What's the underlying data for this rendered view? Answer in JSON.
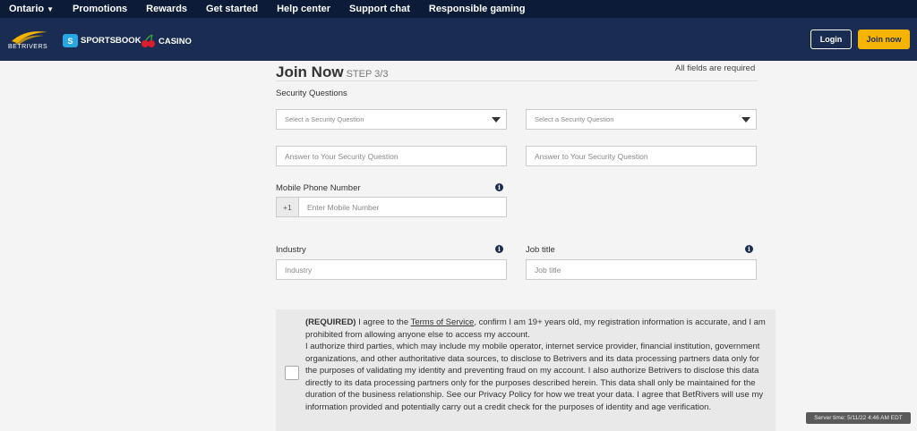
{
  "topnav": {
    "items": [
      "Ontario",
      "Promotions",
      "Rewards",
      "Get started",
      "Help center",
      "Support chat",
      "Responsible gaming"
    ]
  },
  "header": {
    "brand": "BETRIVERS",
    "sportsbook_badge": "S",
    "sportsbook": "SPORTSBOOK",
    "casino": "CASINO",
    "login": "Login",
    "join": "Join now"
  },
  "form": {
    "title": "Join Now",
    "step": "STEP 3/3",
    "required_note": "All fields are required",
    "security_label": "Security Questions",
    "question_placeholder": "Select a Security Question",
    "answer_placeholder": "Answer to Your Security Question",
    "mobile_label": "Mobile Phone Number",
    "mobile_prefix": "+1",
    "mobile_placeholder": "Enter Mobile Number",
    "industry_label": "Industry",
    "industry_placeholder": "Industry",
    "job_label": "Job title",
    "job_placeholder": "Job title",
    "info_glyph": "i"
  },
  "terms": {
    "required_tag": "(REQUIRED)",
    "p1_before": " I agree to the ",
    "tos_link": "Terms of Service",
    "p1_after": ", confirm I am 19+ years old, my registration information is accurate, and I am prohibited from allowing anyone else to access my account.",
    "p2": "I authorize third parties, which may include my mobile operator, internet service provider, financial institution, government organizations, and other authoritative data sources, to disclose to Betrivers and its data processing partners data only for the purposes of validating my identity and preventing fraud on my account. I also authorize Betrivers to disclose this data directly to its data processing partners only for the purposes described herein. This data shall only be maintained for the duration of the business relationship. See our Privacy Policy for how we treat your data. I agree that BetRivers will use my information provided and potentially carry out a credit check for the purposes of identity and age verification."
  },
  "server_time": "Server time: 5/11/22 4:46 AM EDT"
}
